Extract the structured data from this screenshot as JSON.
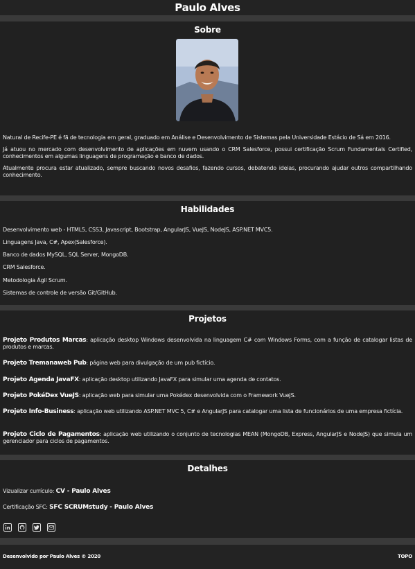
{
  "header": {
    "title": "Paulo Alves"
  },
  "sobre": {
    "title": "Sobre",
    "paragraphs": [
      "Natural de Recife-PE é fã de tecnologia em geral, graduado em Análise e Desenvolvimento de Sistemas pela Universidade Estácio de Sá em 2016.",
      "Já atuou no mercado com desenvolvimento de aplicações em nuvem usando o CRM Salesforce, possui certificação Scrum Fundamentals Certified, conhecimentos em algumas linguagens de programação e banco de dados.",
      "Atualmente procura estar atualizado, sempre buscando novos desafios, fazendo cursos, debatendo ideias, procurando ajudar outros compartilhando conhecimento."
    ]
  },
  "habilidades": {
    "title": "Habilidades",
    "items": [
      "Desenvolvimento web - HTML5, CSS3, Javascript, Bootstrap, AngularJS, VueJS, NodeJS, ASP.NET MVC5.",
      "Linguagens Java, C#, Apex(Salesforce).",
      "Banco de dados MySQL, SQL Server, MongoDB.",
      "CRM Salesforce.",
      "Metodologia Ágil Scrum.",
      "Sistemas de controle de versão Git/GitHub."
    ]
  },
  "projetos": {
    "title": "Projetos",
    "items": [
      {
        "name": "Projeto Produtos Marcas",
        "desc": ": aplicação desktop Windows desenvolvida na linguagem C# com Windows Forms, com a função de catalogar listas de produtos e marcas."
      },
      {
        "name": "Projeto Tremanaweb Pub",
        "desc": ": página web para divulgação de um pub fictício."
      },
      {
        "name": "Projeto Agenda JavaFX",
        "desc": ": aplicação desktop utilizando JavaFX para simular uma agenda de contatos."
      },
      {
        "name": "Projeto PokéDex VueJS",
        "desc": ": aplicação web para simular uma Pokédex desenvolvida com o Framework VueJS."
      },
      {
        "name": "Projeto Info-Business",
        "desc": ": aplicação web utilizando ASP.NET MVC 5, C# e AngularJS para catalogar uma lista de funcionários de uma empresa fictícia."
      },
      {
        "name": "Projeto Ciclo de Pagamentos",
        "desc": ": aplicação web utilizando o conjunto de tecnologias MEAN (MongoDB, Express, AngularJS e NodeJS) que simula um gerenciador para ciclos de pagamentos."
      }
    ]
  },
  "detalhes": {
    "title": "Detalhes",
    "cv_label": "Vizualizar currículo: ",
    "cv_link": "CV - Paulo Alves",
    "sfc_label": "Certificação SFC: ",
    "sfc_link": "SFC SCRUMstudy - Paulo Alves",
    "social_icons": [
      "linkedin-icon",
      "github-icon",
      "twitter-icon",
      "email-icon"
    ]
  },
  "footer": {
    "copyright": "Desenvolvido por Paulo Alves © 2020",
    "top_link": "TOPO"
  }
}
